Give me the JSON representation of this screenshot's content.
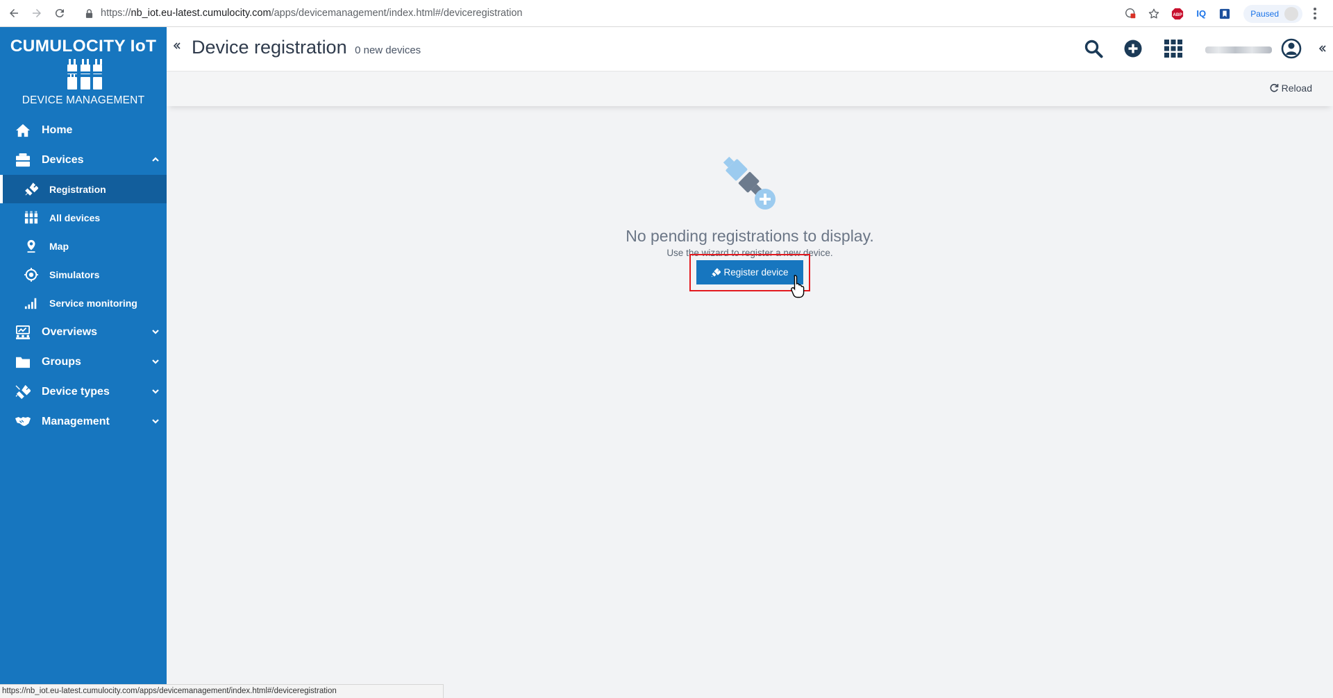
{
  "browser": {
    "url_prefix": "https://",
    "url_host": "nb_iot.eu-latest.cumulocity.com",
    "url_path": "/apps/devicemanagement/index.html#/deviceregistration",
    "paused_label": "Paused",
    "ext_abp": "ABP",
    "ext_iq": "IQ"
  },
  "sidebar": {
    "brand": "CUMULOCITY IoT",
    "app_name": "DEVICE MANAGEMENT",
    "items": [
      {
        "label": "Home",
        "icon": "home-icon"
      },
      {
        "label": "Devices",
        "icon": "devices-icon"
      },
      {
        "label": "Overviews",
        "icon": "overviews-icon"
      },
      {
        "label": "Groups",
        "icon": "folder-icon"
      },
      {
        "label": "Device types",
        "icon": "device-types-icon"
      },
      {
        "label": "Management",
        "icon": "handshake-icon"
      }
    ],
    "devices_sub": [
      {
        "label": "Registration",
        "icon": "plug-icon"
      },
      {
        "label": "All devices",
        "icon": "devices-grid-icon"
      },
      {
        "label": "Map",
        "icon": "map-pin-icon"
      },
      {
        "label": "Simulators",
        "icon": "simulator-icon"
      },
      {
        "label": "Service monitoring",
        "icon": "signal-bars-icon"
      }
    ]
  },
  "header": {
    "title": "Device registration",
    "count_label": "0 new devices"
  },
  "actions": {
    "reload": "Reload"
  },
  "empty_state": {
    "title": "No pending registrations to display.",
    "subtitle": "Use the wizard to register a new device.",
    "button": "Register device"
  },
  "status_bar": {
    "url": "https://nb_iot.eu-latest.cumulocity.com/apps/devicemanagement/index.html#/deviceregistration"
  },
  "colors": {
    "sidebar": "#1776bf",
    "sidebar_active": "#125e9c",
    "highlight": "#e3191e",
    "icon_dark": "#1b3a57"
  }
}
